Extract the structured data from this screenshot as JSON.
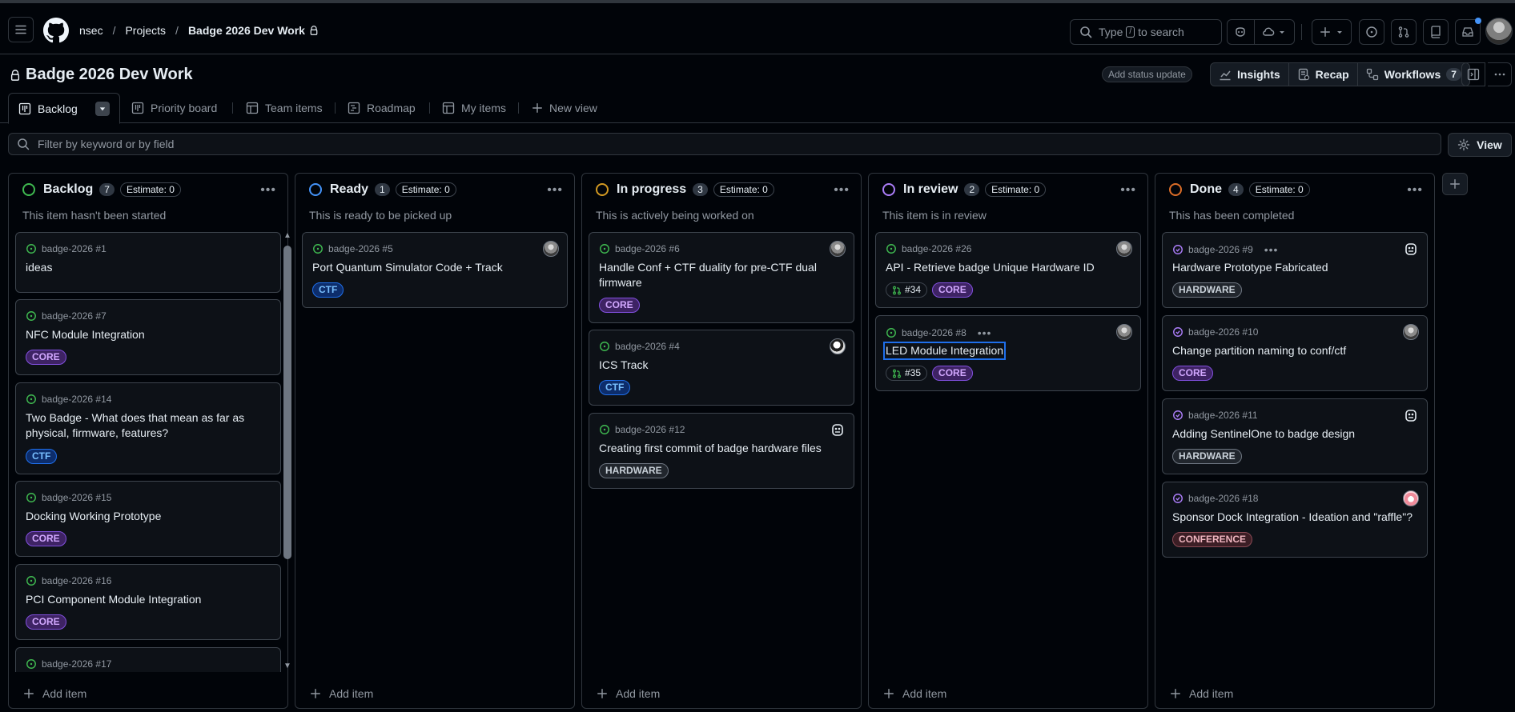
{
  "header": {
    "breadcrumbs": [
      "nsec",
      "Projects",
      "Badge 2026 Dev Work"
    ],
    "search_prefix": "Type",
    "search_key": "/",
    "search_suffix": "to search"
  },
  "project": {
    "title": "Badge 2026 Dev Work",
    "status_update": "Add status update",
    "insights": "Insights",
    "recap": "Recap",
    "workflows": "Workflows",
    "workflows_count": "7"
  },
  "tabs": [
    {
      "label": "Backlog"
    },
    {
      "label": "Priority board"
    },
    {
      "label": "Team items"
    },
    {
      "label": "Roadmap"
    },
    {
      "label": "My items"
    },
    {
      "label": "New view"
    }
  ],
  "filter": {
    "placeholder": "Filter by keyword or by field"
  },
  "view_button": "View",
  "add_item": "Add item",
  "colors": {
    "green": "#3fb950",
    "blue": "#4493f8",
    "yellow": "#d29922",
    "purple": "#ab7df8",
    "orange": "#db6d28"
  },
  "columns": [
    {
      "title": "Backlog",
      "count": "7",
      "estimate": "Estimate: 0",
      "description": "This item hasn't been started",
      "cards": [
        {
          "ref": "badge-2026 #1",
          "title": "ideas"
        },
        {
          "ref": "badge-2026 #7",
          "title": "NFC Module Integration",
          "label": "CORE"
        },
        {
          "ref": "badge-2026 #14",
          "title": "Two Badge - What does that mean as far as physical, firmware, features?",
          "label": "CTF"
        },
        {
          "ref": "badge-2026 #15",
          "title": "Docking Working Prototype",
          "label": "CORE"
        },
        {
          "ref": "badge-2026 #16",
          "title": "PCI Component Module Integration",
          "label": "CORE"
        },
        {
          "ref": "badge-2026 #17"
        }
      ]
    },
    {
      "title": "Ready",
      "count": "1",
      "estimate": "Estimate: 0",
      "description": "This is ready to be picked up",
      "cards": [
        {
          "ref": "badge-2026 #5",
          "title": "Port Quantum Simulator Code + Track",
          "label": "CTF"
        }
      ]
    },
    {
      "title": "In progress",
      "count": "3",
      "estimate": "Estimate: 0",
      "description": "This is actively being worked on",
      "cards": [
        {
          "ref": "badge-2026 #6",
          "title": "Handle Conf + CTF duality for pre-CTF dual firmware",
          "label": "CORE"
        },
        {
          "ref": "badge-2026 #4",
          "title": "ICS Track",
          "label": "CTF"
        },
        {
          "ref": "badge-2026 #12",
          "title": "Creating first commit of badge hardware files",
          "label": "HARDWARE"
        }
      ]
    },
    {
      "title": "In review",
      "count": "2",
      "estimate": "Estimate: 0",
      "description": "This item is in review",
      "cards": [
        {
          "ref": "badge-2026 #26",
          "title": "API - Retrieve badge Unique Hardware ID",
          "pr": "#34",
          "label": "CORE"
        },
        {
          "ref": "badge-2026 #8",
          "title": "LED Module Integration",
          "pr": "#35",
          "label": "CORE"
        }
      ]
    },
    {
      "title": "Done",
      "count": "4",
      "estimate": "Estimate: 0",
      "description": "This has been completed",
      "cards": [
        {
          "ref": "badge-2026 #9",
          "title": "Hardware Prototype Fabricated",
          "label": "HARDWARE"
        },
        {
          "ref": "badge-2026 #10",
          "title": "Change partition naming to conf/ctf",
          "label": "CORE"
        },
        {
          "ref": "badge-2026 #11",
          "title": "Adding SentinelOne to badge design",
          "label": "HARDWARE"
        },
        {
          "ref": "badge-2026 #18",
          "title": "Sponsor Dock Integration - Ideation and \"raffle\"?",
          "label": "CONFERENCE"
        }
      ]
    }
  ]
}
